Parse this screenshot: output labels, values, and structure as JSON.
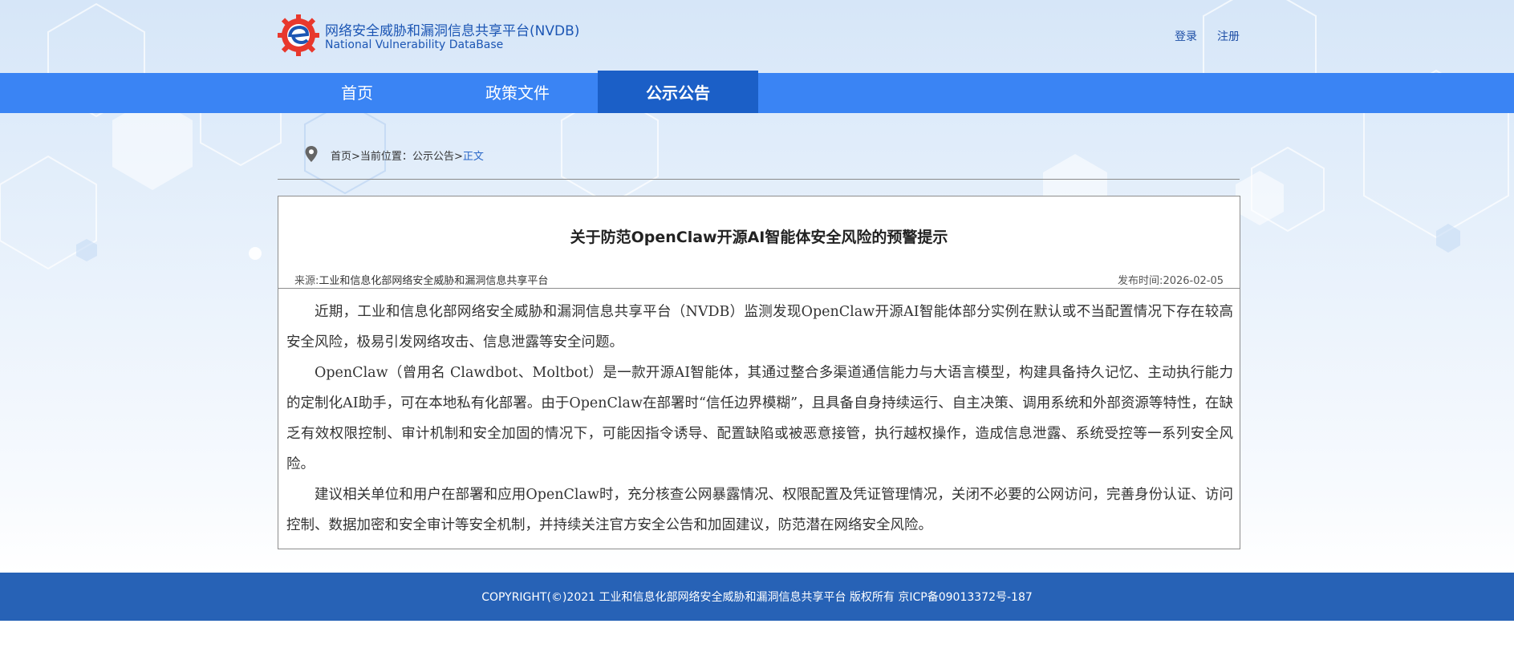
{
  "header": {
    "site_title": "网络安全威胁和漏洞信息共享平台(NVDB)",
    "site_subtitle": "National Vulnerability DataBase",
    "login": "登录",
    "register": "注册"
  },
  "nav": {
    "items": [
      {
        "label": "首页"
      },
      {
        "label": "政策文件"
      },
      {
        "label": "公示公告",
        "active": true
      }
    ]
  },
  "breadcrumb": {
    "home": "首页",
    "sep1": ">",
    "current_prefix": "当前位置：",
    "section": "公示公告",
    "sep2": ">",
    "current": "正文"
  },
  "article": {
    "title": "关于防范OpenClaw开源AI智能体安全风险的预警提示",
    "source_label": "来源:",
    "source": "工业和信息化部网络安全威胁和漏洞信息共享平台",
    "date_label": "发布时间:",
    "date": "2026-02-05",
    "paragraphs": [
      "近期，工业和信息化部网络安全威胁和漏洞信息共享平台（NVDB）监测发现OpenClaw开源AI智能体部分实例在默认或不当配置情况下存在较高安全风险，极易引发网络攻击、信息泄露等安全问题。",
      "OpenClaw（曾用名 Clawdbot、Moltbot）是一款开源AI智能体，其通过整合多渠道通信能力与大语言模型，构建具备持久记忆、主动执行能力的定制化AI助手，可在本地私有化部署。由于OpenClaw在部署时“信任边界模糊”，且具备自身持续运行、自主决策、调用系统和外部资源等特性，在缺乏有效权限控制、审计机制和安全加固的情况下，可能因指令诱导、配置缺陷或被恶意接管，执行越权操作，造成信息泄露、系统受控等一系列安全风险。",
      "建议相关单位和用户在部署和应用OpenClaw时，充分核查公网暴露情况、权限配置及凭证管理情况，关闭不必要的公网访问，完善身份认证、访问控制、数据加密和安全审计等安全机制，并持续关注官方安全公告和加固建议，防范潜在网络安全风险。"
    ]
  },
  "footer": {
    "copyright": "COPYRIGHT(©)2021 工业和信息化部网络安全威胁和漏洞信息共享平台 版权所有   京ICP备09013372号-187"
  },
  "colors": {
    "nav_bg": "#3a84f4",
    "nav_active": "#1b5fc7",
    "brand_blue": "#1c56b4",
    "footer_bg": "#2762b6",
    "logo_red": "#e8382d"
  }
}
